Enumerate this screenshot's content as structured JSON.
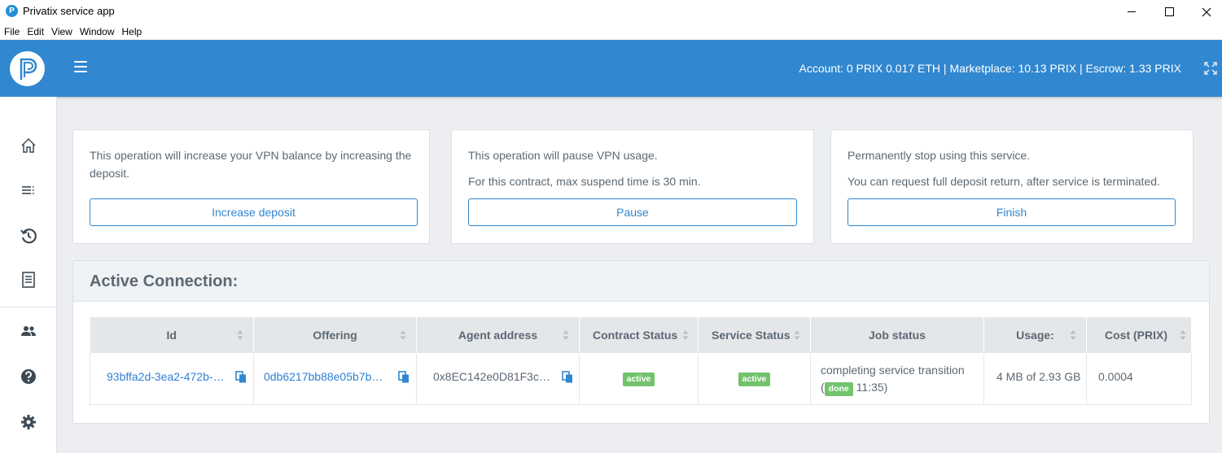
{
  "window": {
    "title": "Privatix service app",
    "app_icon_letter": "P"
  },
  "menu": [
    "File",
    "Edit",
    "View",
    "Window",
    "Help"
  ],
  "topnav": {
    "account_info": "Account: 0 PRIX  0.017 ETH | Marketplace: 10.13 PRIX | Escrow: 1.33 PRIX",
    "menu_icon": "hamburger-icon",
    "expand_icon": "expand-icon",
    "brand_color": "#3187d0"
  },
  "sidebar": {
    "items": [
      {
        "name": "home",
        "icon": "home-icon"
      },
      {
        "name": "list",
        "icon": "list-icon"
      },
      {
        "name": "history",
        "icon": "history-icon"
      },
      {
        "name": "document",
        "icon": "document-icon"
      },
      {
        "name": "users",
        "icon": "users-icon"
      },
      {
        "name": "help",
        "icon": "help-icon"
      },
      {
        "name": "settings",
        "icon": "gear-icon"
      }
    ]
  },
  "cards": {
    "deposit": {
      "text": "This operation will increase your VPN balance by increasing the deposit.",
      "button": "Increase deposit"
    },
    "pause": {
      "text1": "This operation will pause VPN usage.",
      "text2": "For this contract, max suspend time is 30 min.",
      "button": "Pause"
    },
    "finish": {
      "text1": "Permanently stop using this service.",
      "text2": "You can request full deposit return, after service is terminated.",
      "button": "Finish"
    }
  },
  "active_connection": {
    "title": "Active Connection:",
    "columns": [
      "Id",
      "Offering",
      "Agent address",
      "Contract Status",
      "Service Status",
      "Job status",
      "Usage:",
      "Cost (PRIX)"
    ],
    "row": {
      "id": "93bffa2d-3ea2-472b-…",
      "offering": "0db6217bb88e05b7b…",
      "agent_address": "0x8EC142e0D81F3c…",
      "contract_status": "active",
      "service_status": "active",
      "job_status_text": "completing service transition",
      "job_status_open": "(",
      "job_status_badge": "done",
      "job_status_time": "11:35)",
      "usage": "4 MB of 2.93 GB",
      "cost": "0.0004"
    },
    "status_color": "#72c36c"
  }
}
